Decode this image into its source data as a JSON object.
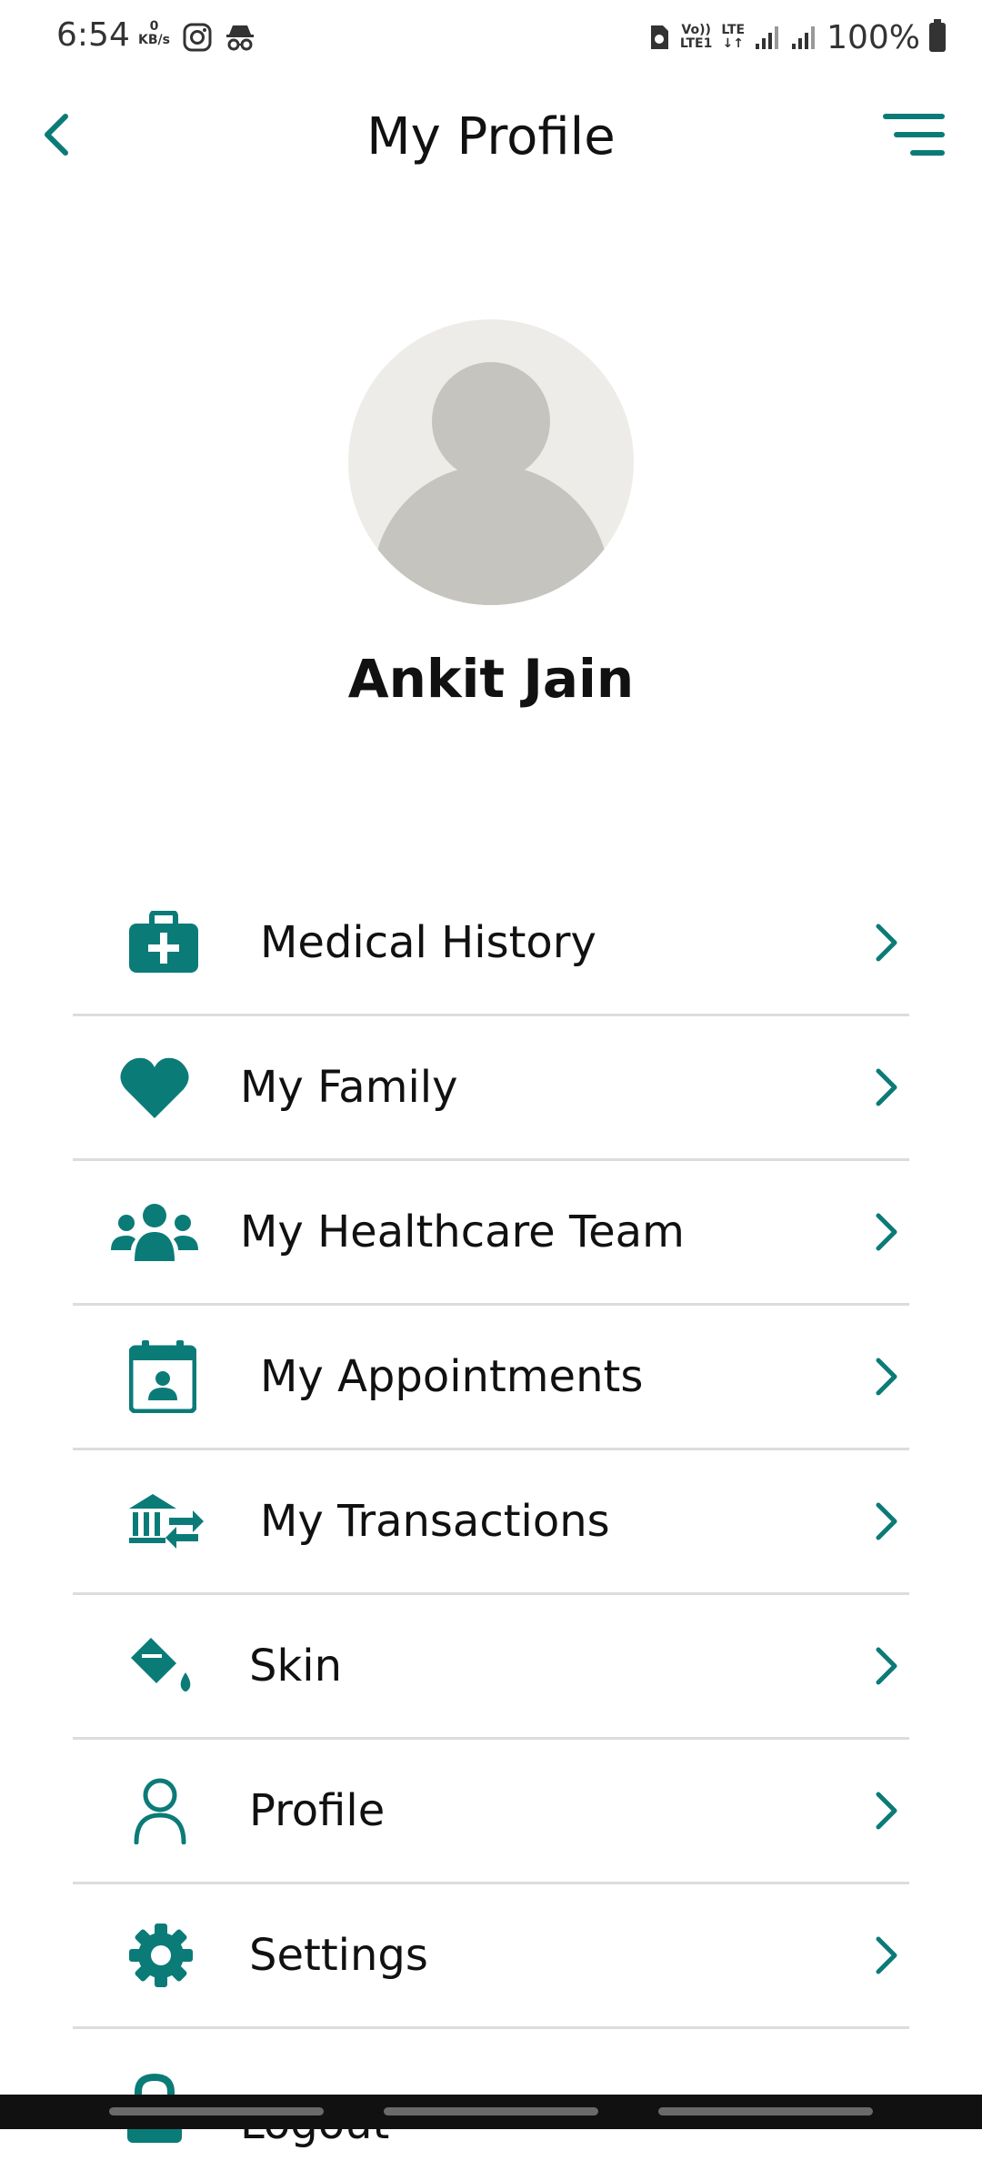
{
  "status_bar": {
    "time": "6:54",
    "net_speed_value": "0",
    "net_speed_unit": "KB/s",
    "volte_line1": "Vo))",
    "volte_line2": "LTE1",
    "lte_label": "LTE",
    "battery": "100%"
  },
  "header": {
    "title": "My Profile"
  },
  "profile": {
    "name": "Ankit Jain"
  },
  "menu": {
    "items": [
      {
        "label": "Medical History",
        "icon": "medical-kit-icon"
      },
      {
        "label": "My Family",
        "icon": "heart-icon"
      },
      {
        "label": "My Healthcare Team",
        "icon": "users-icon"
      },
      {
        "label": "My Appointments",
        "icon": "calendar-user-icon"
      },
      {
        "label": "My Transactions",
        "icon": "bank-transfer-icon"
      },
      {
        "label": "Skin",
        "icon": "paint-bucket-icon"
      },
      {
        "label": "Profile",
        "icon": "user-outline-icon"
      },
      {
        "label": "Settings",
        "icon": "gear-icon"
      },
      {
        "label": "Logout",
        "icon": "lock-icon"
      }
    ]
  },
  "colors": {
    "accent": "#0b7b78",
    "divider": "#dcdcdc",
    "avatar_bg": "#eeece8",
    "avatar_fg": "#c6c4bf"
  }
}
